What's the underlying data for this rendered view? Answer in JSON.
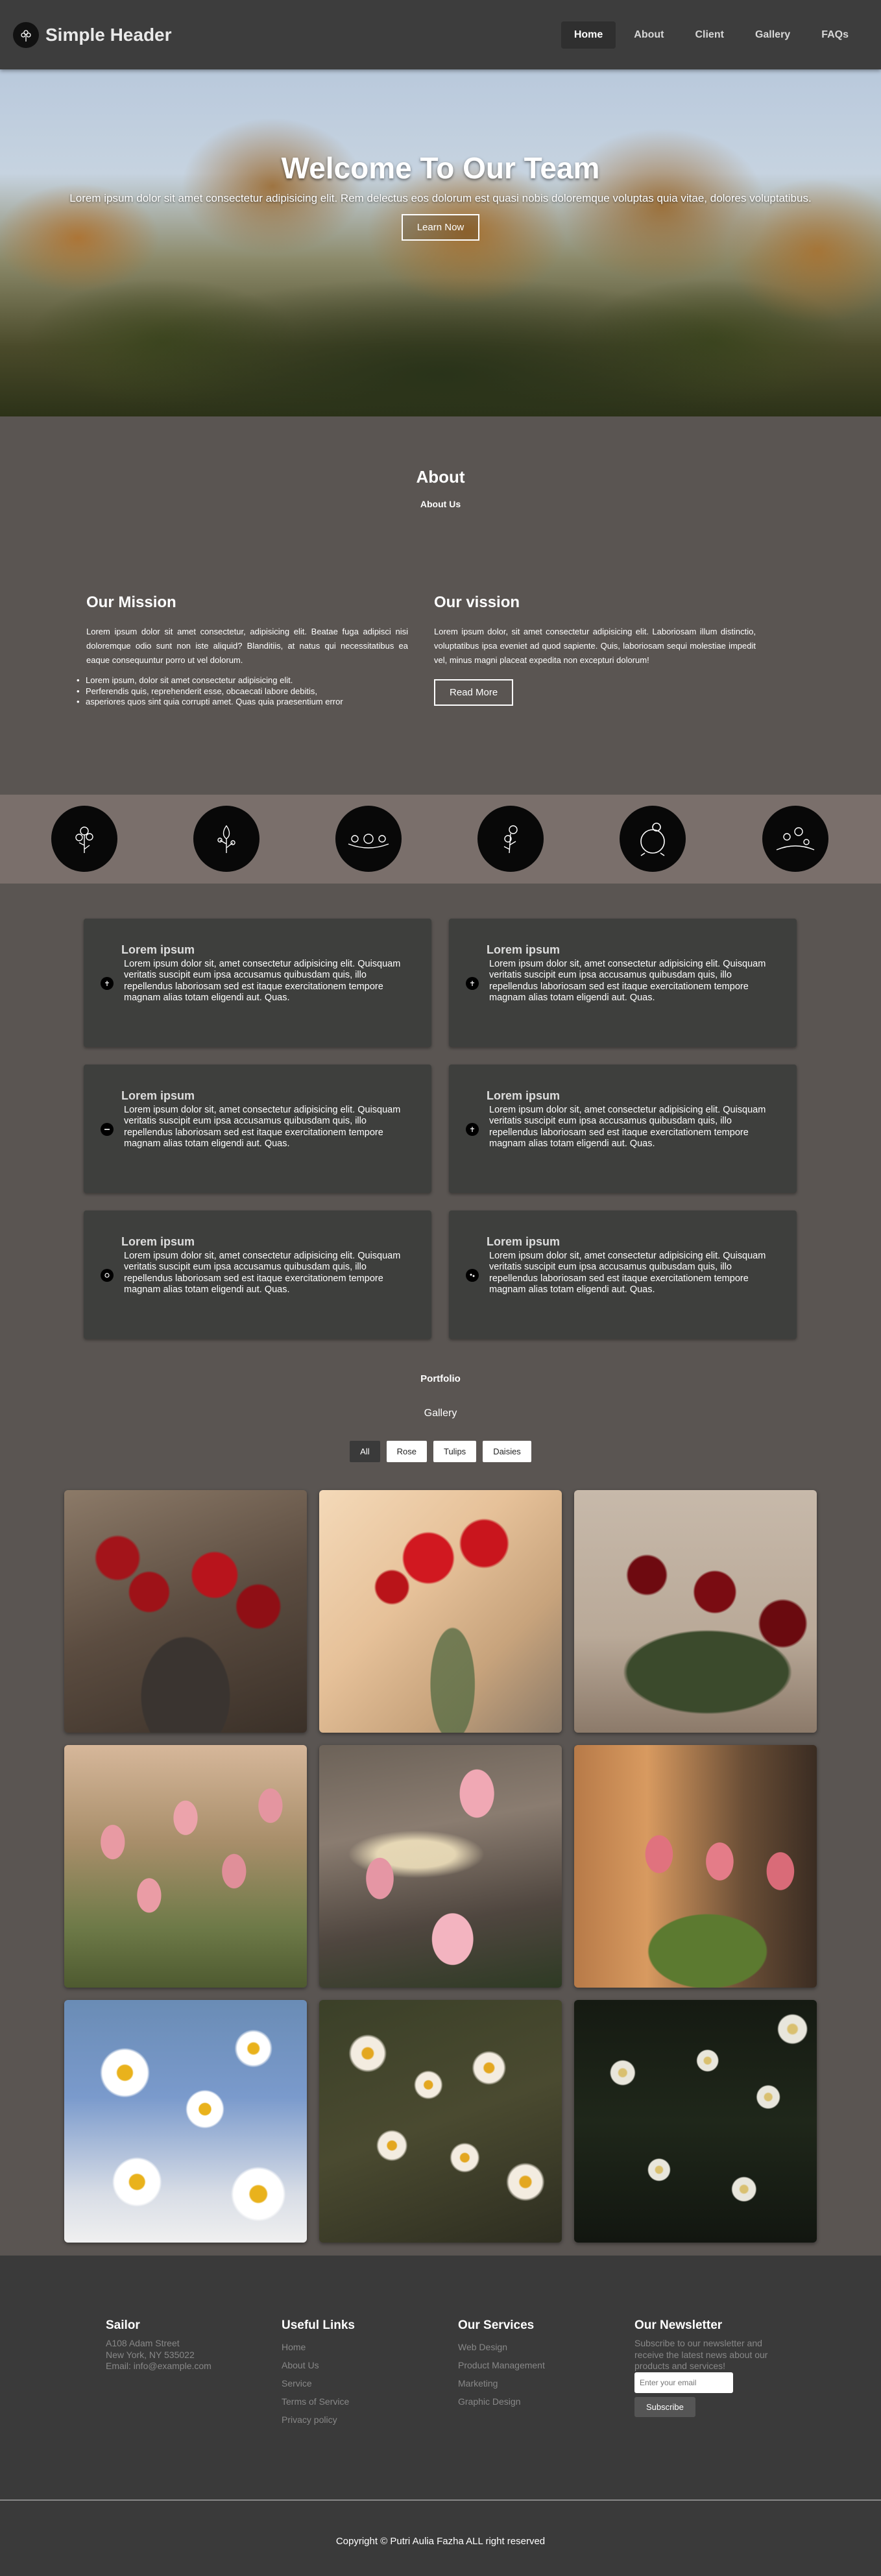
{
  "header": {
    "brand": "Simple Header",
    "nav": [
      {
        "label": "Home",
        "active": true
      },
      {
        "label": "About"
      },
      {
        "label": "Client"
      },
      {
        "label": "Gallery"
      },
      {
        "label": "FAQs"
      }
    ]
  },
  "hero": {
    "title": "Welcome To Our Team",
    "text": "Lorem ipsum dolor sit amet consectetur adipisicing elit. Rem delectus eos dolorum est quasi nobis doloremque voluptas quia vitae, dolores voluptatibus.",
    "button": "Learn Now"
  },
  "about": {
    "title": "About",
    "subtitle": "About Us",
    "mission": {
      "title": "Our Mission",
      "text": "Lorem ipsum dolor sit amet consectetur, adipisicing elit. Beatae fuga adipisci nisi doloremque odio sunt non iste aliquid? Blanditiis, at natus qui necessitatibus ea eaque consequuntur porro ut vel dolorum.",
      "list": [
        "Lorem ipsum, dolor sit amet consectetur adipisicing elit.",
        "Perferendis quis, reprehenderit esse, obcaecati labore debitis,",
        "asperiores quos sint quia corrupti amet. Quas quia praesentium error"
      ]
    },
    "vision": {
      "title": "Our vission",
      "text": "Lorem ipsum dolor, sit amet consectetur adipisicing elit. Laboriosam illum distinctio, voluptatibus ipsa eveniet ad quod sapiente. Quis, laboriosam sequi molestiae impedit vel, minus magni placeat expedita non excepturi dolorum!",
      "button": "Read More"
    }
  },
  "features": {
    "cards": [
      {
        "title": "Lorem ipsum",
        "text": "Lorem ipsum dolor sit, amet consectetur adipisicing elit. Quisquam veritatis suscipit eum ipsa accusamus quibusdam quis, illo repellendus laboriosam sed est itaque exercitationem tempore magnam alias totam eligendi aut. Quas.",
        "icon": "flower-icon"
      },
      {
        "title": "Lorem ipsum",
        "text": "Lorem ipsum dolor sit, amet consectetur adipisicing elit. Quisquam veritatis suscipit eum ipsa accusamus quibusdam quis, illo repellendus laboriosam sed est itaque exercitationem tempore magnam alias totam eligendi aut. Quas.",
        "icon": "flower-icon"
      },
      {
        "title": "Lorem ipsum",
        "text": "Lorem ipsum dolor sit, amet consectetur adipisicing elit. Quisquam veritatis suscipit eum ipsa accusamus quibusdam quis, illo repellendus laboriosam sed est itaque exercitationem tempore magnam alias totam eligendi aut. Quas.",
        "icon": "flower-icon"
      },
      {
        "title": "Lorem ipsum",
        "text": "Lorem ipsum dolor sit, amet consectetur adipisicing elit. Quisquam veritatis suscipit eum ipsa accusamus quibusdam quis, illo repellendus laboriosam sed est itaque exercitationem tempore magnam alias totam eligendi aut. Quas.",
        "icon": "flower-icon"
      },
      {
        "title": "Lorem ipsum",
        "text": "Lorem ipsum dolor sit, amet consectetur adipisicing elit. Quisquam veritatis suscipit eum ipsa accusamus quibusdam quis, illo repellendus laboriosam sed est itaque exercitationem tempore magnam alias totam eligendi aut. Quas.",
        "icon": "flower-icon"
      },
      {
        "title": "Lorem ipsum",
        "text": "Lorem ipsum dolor sit, amet consectetur adipisicing elit. Quisquam veritatis suscipit eum ipsa accusamus quibusdam quis, illo repellendus laboriosam sed est itaque exercitationem tempore magnam alias totam eligendi aut. Quas.",
        "icon": "flower-icon"
      }
    ]
  },
  "portfolio": {
    "label": "Portfolio",
    "gallery_label": "Gallery",
    "filters": [
      {
        "label": "All",
        "active": true
      },
      {
        "label": "Rose"
      },
      {
        "label": "Tulips"
      },
      {
        "label": "Daisies"
      }
    ]
  },
  "footer": {
    "company": {
      "title": "Sailor",
      "lines": [
        "A108 Adam Street",
        "New York, NY 535022",
        "Email: info@example.com"
      ]
    },
    "useful_links": {
      "title": "Useful Links",
      "links": [
        "Home",
        "About Us",
        "Service",
        "Terms of Service",
        "Privacy policy"
      ]
    },
    "services": {
      "title": "Our Services",
      "links": [
        "Web Design",
        "Product Management",
        "Marketing",
        "Graphic Design"
      ]
    },
    "newsletter": {
      "title": "Our Newsletter",
      "text": "Subscribe to our newsletter and receive the latest news about our products and services!",
      "placeholder": "Enter your email",
      "button": "Subscribe"
    },
    "copyright": "Copyright © Putri Aulia Fazha ALL right reserved"
  },
  "colors": {
    "page_bg": "#5a5552",
    "nav_bg": "#3d3d3d",
    "band_bg": "#7a6f6b",
    "card_bg": "#3e3f3d",
    "footer_bg": "#3a3a3a"
  }
}
